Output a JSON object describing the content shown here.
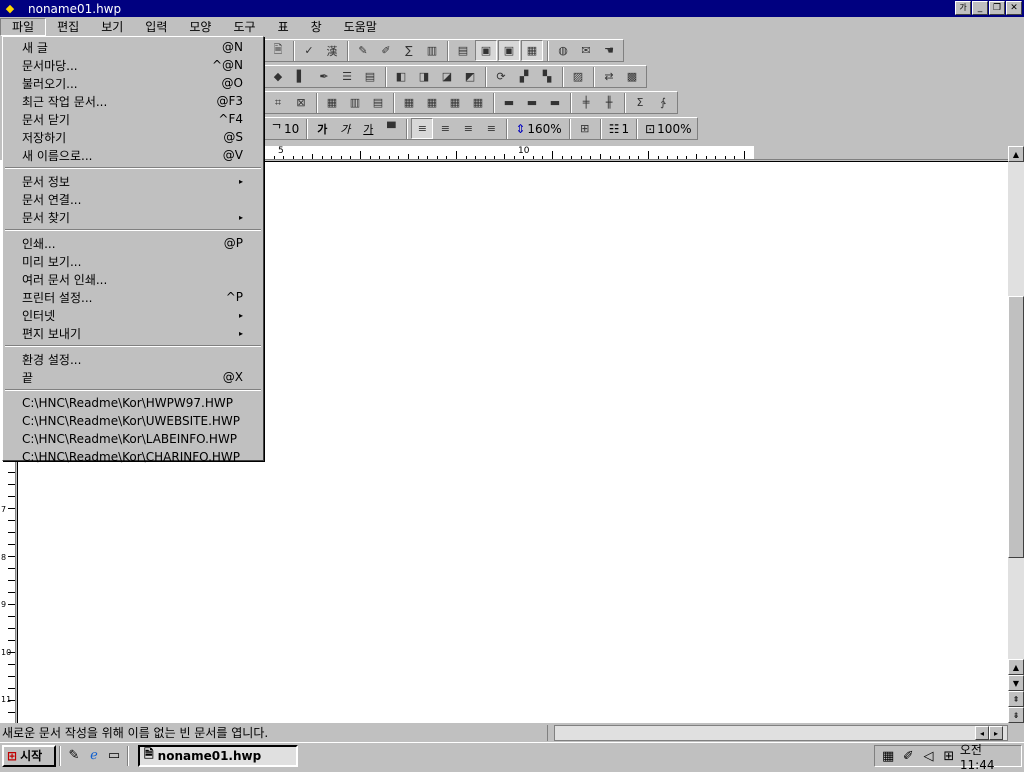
{
  "window": {
    "title": "noname01.hwp"
  },
  "menubar": {
    "items": [
      "파일",
      "편집",
      "보기",
      "입력",
      "모양",
      "도구",
      "표",
      "창",
      "도움말"
    ]
  },
  "file_menu": {
    "groups": [
      [
        {
          "label": "새 글",
          "shortcut": "@N"
        },
        {
          "label": "문서마당...",
          "shortcut": "^@N"
        },
        {
          "label": "불러오기...",
          "shortcut": "@O"
        },
        {
          "label": "최근 작업 문서...",
          "shortcut": "@F3"
        },
        {
          "label": "문서 닫기",
          "shortcut": "^F4"
        },
        {
          "label": "저장하기",
          "shortcut": "@S"
        },
        {
          "label": "새 이름으로...",
          "shortcut": "@V"
        }
      ],
      [
        {
          "label": "문서 정보",
          "shortcut": "▸"
        },
        {
          "label": "문서 연결...",
          "shortcut": ""
        },
        {
          "label": "문서 찾기",
          "shortcut": "▸"
        }
      ],
      [
        {
          "label": "인쇄...",
          "shortcut": "@P"
        },
        {
          "label": "미리 보기...",
          "shortcut": ""
        },
        {
          "label": "여러 문서 인쇄...",
          "shortcut": ""
        },
        {
          "label": "프린터 설정...",
          "shortcut": "^P"
        },
        {
          "label": "인터넷",
          "shortcut": "▸"
        },
        {
          "label": "편지 보내기",
          "shortcut": "▸"
        }
      ],
      [
        {
          "label": "환경 설정...",
          "shortcut": ""
        },
        {
          "label": "끝",
          "shortcut": "@X"
        }
      ],
      [
        {
          "label": "C:\\HNC\\Readme\\Kor\\HWPW97.HWP",
          "shortcut": ""
        },
        {
          "label": "C:\\HNC\\Readme\\Kor\\UWEBSITE.HWP",
          "shortcut": ""
        },
        {
          "label": "C:\\HNC\\Readme\\Kor\\LABEINFO.HWP",
          "shortcut": ""
        },
        {
          "label": "C:\\HNC\\Readme\\Kor\\CHARINFO.HWP",
          "shortcut": ""
        }
      ]
    ]
  },
  "format_toolbar": {
    "font_size": "10",
    "bold": "가",
    "italic": "가",
    "underline": "가",
    "line_spacing": "160%",
    "columns": "1",
    "zoom": "100%"
  },
  "ruler": {
    "numbers": [
      "5",
      "10"
    ]
  },
  "vertical_ruler": {
    "numbers": [
      "7",
      "8",
      "9",
      "10",
      "11"
    ]
  },
  "statusbar": {
    "text": "새로운 문서 작성을 위해 이름 없는 빈 문서를 엽니다."
  },
  "taskbar": {
    "start_label": "시작",
    "task_label": "noname01.hwp",
    "clock": "오전 11:44"
  }
}
